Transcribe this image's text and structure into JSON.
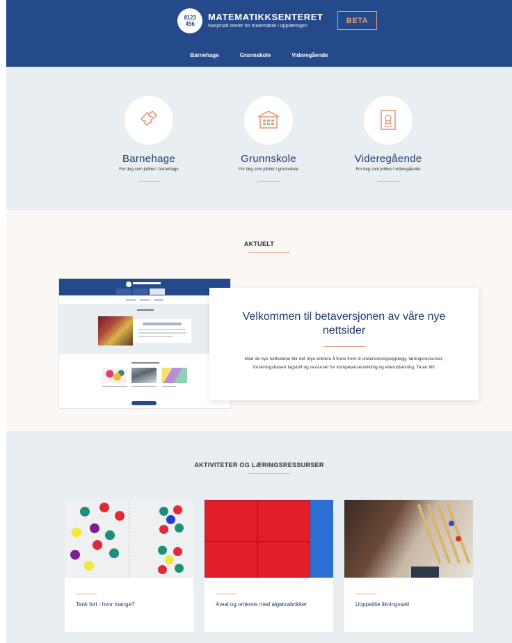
{
  "header": {
    "logo_glyph": "0123\n456",
    "title": "MATEMATIKKSENTERET",
    "subtitle": "Nasjonalt senter for matematikk i opplæringen",
    "beta": "BETA",
    "nav": [
      "Barnehage",
      "Grunnskole",
      "Videregående"
    ]
  },
  "levels": [
    {
      "title": "Barnehage",
      "desc": "For deg som jobber i barnehage",
      "icon": "puzzle-icon"
    },
    {
      "title": "Grunnskole",
      "desc": "For deg som jobber i grunnskole",
      "icon": "school-building-icon"
    },
    {
      "title": "Videregående",
      "desc": "For deg som jobber i videregående",
      "icon": "certificate-icon"
    }
  ],
  "aktuelt": {
    "heading": "AKTUELT",
    "card_title": "Velkommen til betaversjonen av våre nye nettsider",
    "card_text": "Med de nye nettsidene blir det mye enklere å finne frem til undervisningsopplegg, læringsressurser, forskningsbasert fagstoff og ressurser for kompetanseutvikling og etterutdanning. Ta en titt!"
  },
  "aktiviteter": {
    "heading": "AKTIVITETER OG LÆRINGSRESSURSER",
    "cards": [
      {
        "title": "Tenk fort - hvor mange?"
      },
      {
        "title": "Areal og omkrets med algebrabrikker"
      },
      {
        "title": "Uoppstilte likningssett"
      }
    ]
  },
  "colors": {
    "primary": "#244a8b",
    "accent": "#e39a7b",
    "light_bg": "#e8eef1",
    "warm_bg": "#faf7f5"
  }
}
